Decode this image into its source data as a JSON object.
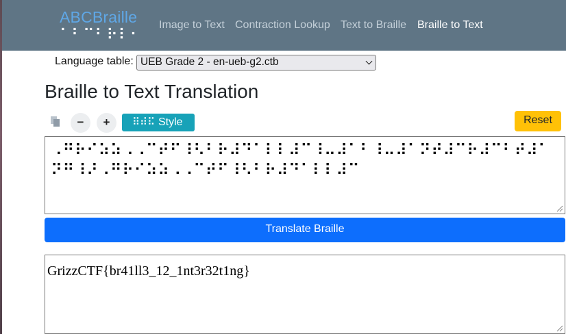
{
  "nav": {
    "logo_text": "ABCBraille",
    "logo_braille": "⠁⠃⠉⠃⠗⠇⠂",
    "links": [
      {
        "label": "Image to Text"
      },
      {
        "label": "Contraction Lookup"
      },
      {
        "label": "Text to Braille"
      },
      {
        "label": "Braille to Text",
        "active": true
      }
    ]
  },
  "language": {
    "label": "Language table:",
    "selected": "UEB Grade 2 - en-ueb-g2.ctb"
  },
  "page_title": "Braille to Text Translation",
  "toolbar": {
    "copy_icon": "copy-icon",
    "decrease_label": "−",
    "increase_label": "+",
    "style_icon": "⠿⠾⠯",
    "style_label": "Style",
    "reset_label": "Reset"
  },
  "braille_input": {
    "value": "⠠⠛⠗⠊⠵⠵⠠⠠⠉⠞⠋⠸⠣⠃⠗⠼⠙⠁⠇⠇⠼⠉⠸⠤⠼⠁⠃⠸⠤⠼⠁⠝⠞⠼⠉⠗⠼⠉⠃⠞⠼⠁⠝⠛⠸⠜⠠⠛⠗⠊⠵⠵⠠⠠⠉⠞⠋⠸⠣⠃⠗⠼⠙⠁⠇⠇⠼⠉"
  },
  "translate_label": "Translate Braille",
  "output": {
    "value": "GrizzCTF{br41ll3_12_1nt3r32t1ng}"
  },
  "colors": {
    "navbar": "#5f7585",
    "logo": "#5fa7e6",
    "style_button": "#17a2b8",
    "reset_button": "#ffc107",
    "translate_button": "#0d6efd"
  }
}
